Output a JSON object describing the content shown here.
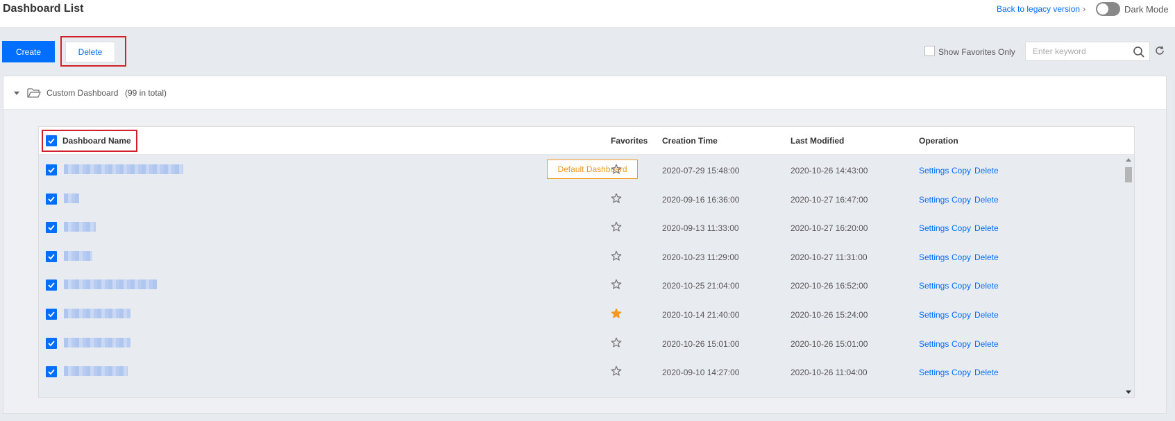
{
  "header": {
    "title": "Dashboard List",
    "legacy_link": "Back to legacy version",
    "dark_mode_label": "Dark Mode",
    "dark_mode_on": false
  },
  "toolbar": {
    "create_label": "Create",
    "delete_label": "Delete",
    "show_favorites_label": "Show Favorites Only",
    "show_favorites_checked": false,
    "search_placeholder": "Enter keyword",
    "search_value": ""
  },
  "group": {
    "name": "Custom Dashboard",
    "count": "(99 in total)",
    "expanded": true
  },
  "table": {
    "columns": {
      "name": "Dashboard Name",
      "favorites": "Favorites",
      "created": "Creation Time",
      "modified": "Last Modified",
      "operation": "Operation"
    },
    "header_checked": true,
    "default_tag": "Default Dashboard",
    "ops": {
      "settings": "Settings",
      "copy": "Copy",
      "delete": "Delete"
    },
    "rows": [
      {
        "name": "",
        "checked": true,
        "default": true,
        "favorite": false,
        "created": "2020-07-29 15:48:00",
        "modified": "2020-10-26 14:43:00"
      },
      {
        "name": "",
        "checked": true,
        "default": false,
        "favorite": false,
        "created": "2020-09-16 16:36:00",
        "modified": "2020-10-27 16:47:00"
      },
      {
        "name": "",
        "checked": true,
        "default": false,
        "favorite": false,
        "created": "2020-09-13 11:33:00",
        "modified": "2020-10-27 16:20:00"
      },
      {
        "name": "",
        "checked": true,
        "default": false,
        "favorite": false,
        "created": "2020-10-23 11:29:00",
        "modified": "2020-10-27 11:31:00"
      },
      {
        "name": "",
        "checked": true,
        "default": false,
        "favorite": false,
        "created": "2020-10-25 21:04:00",
        "modified": "2020-10-26 16:52:00"
      },
      {
        "name": "",
        "checked": true,
        "default": false,
        "favorite": true,
        "created": "2020-10-14 21:40:00",
        "modified": "2020-10-26 15:24:00"
      },
      {
        "name": "",
        "checked": true,
        "default": false,
        "favorite": false,
        "created": "2020-10-26 15:01:00",
        "modified": "2020-10-26 15:01:00"
      },
      {
        "name": "",
        "checked": true,
        "default": false,
        "favorite": false,
        "created": "2020-09-10 14:27:00",
        "modified": "2020-10-26 11:04:00"
      }
    ]
  },
  "colors": {
    "primary": "#006eff",
    "highlight": "#d0202a",
    "favorite": "#f39a1e",
    "default_tag": "#f39a1e"
  }
}
